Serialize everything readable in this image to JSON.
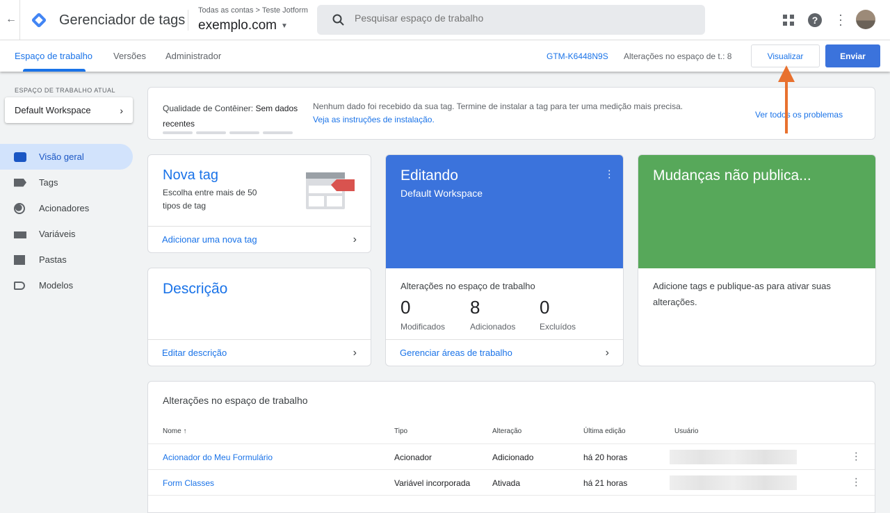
{
  "header": {
    "app_title": "Gerenciador de tags",
    "breadcrumb": "Todas as contas > Teste Jotform",
    "container": "exemplo.com",
    "search_placeholder": "Pesquisar espaço de trabalho"
  },
  "tabs": [
    {
      "label": "Espaço de trabalho"
    },
    {
      "label": "Versões"
    },
    {
      "label": "Administrador"
    }
  ],
  "subbar": {
    "container_id": "GTM-K6448N9S",
    "changes": "Alterações no espaço de t.: 8",
    "preview": "Visualizar",
    "submit": "Enviar"
  },
  "sidebar": {
    "section_label": "ESPAÇO DE TRABALHO ATUAL",
    "workspace": "Default Workspace",
    "items": [
      {
        "label": "Visão geral"
      },
      {
        "label": "Tags"
      },
      {
        "label": "Acionadores"
      },
      {
        "label": "Variáveis"
      },
      {
        "label": "Pastas"
      },
      {
        "label": "Modelos"
      }
    ]
  },
  "quality": {
    "label": "Qualidade de Contêiner:",
    "value": "Sem dados",
    "value2": "recentes",
    "message": "Nenhum dado foi recebido da sua tag. Termine de instalar a tag para ter uma medição mais precisa.",
    "instructions": "Veja as instruções de instalação.",
    "all_problems": "Ver todos os problemas"
  },
  "new_tag": {
    "title": "Nova tag",
    "desc1": "Escolha entre mais de 50",
    "desc2": "tipos de tag",
    "action": "Adicionar uma nova tag"
  },
  "description": {
    "title": "Descrição",
    "action": "Editar descrição"
  },
  "editing": {
    "title": "Editando",
    "workspace": "Default Workspace",
    "changes_label": "Alterações no espaço de trabalho",
    "stats": [
      {
        "value": "0",
        "label": "Modificados"
      },
      {
        "value": "8",
        "label": "Adicionados"
      },
      {
        "value": "0",
        "label": "Excluídos"
      }
    ],
    "action": "Gerenciar áreas de trabalho"
  },
  "unpublished": {
    "title": "Mudanças não publica...",
    "text1": "Adicione tags e publique-as para ativar suas",
    "text2": "alterações."
  },
  "changes_table": {
    "title": "Alterações no espaço de trabalho",
    "columns": [
      "Nome ↑",
      "Tipo",
      "Alteração",
      "Última edição",
      "Usuário"
    ],
    "rows": [
      {
        "name": "Acionador do Meu Formulário",
        "type": "Acionador",
        "change": "Adicionado",
        "edited": "há 20 horas"
      },
      {
        "name": "Form Classes",
        "type": "Variável incorporada",
        "change": "Ativada",
        "edited": "há 21 horas"
      }
    ]
  },
  "colors": {
    "accent": "#1a73e8",
    "editing": "#3b73dc",
    "unpublished": "#57a85a",
    "arrow": "#e8712f"
  }
}
